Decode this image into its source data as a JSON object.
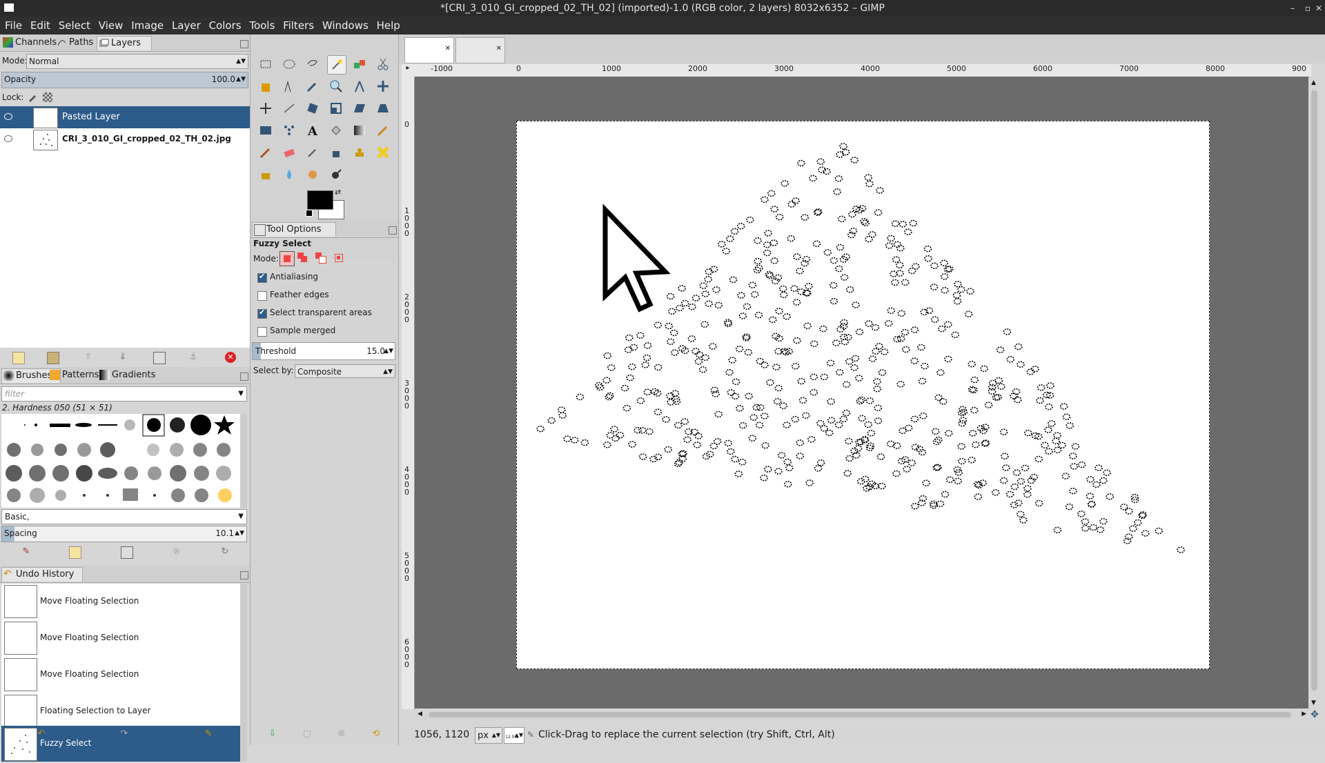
{
  "window": {
    "title": "*[CRI_3_010_GI_cropped_02_TH_02] (imported)-1.0 (RGB color, 2 layers) 8032x6352 – GIMP"
  },
  "menu": [
    "File",
    "Edit",
    "Select",
    "View",
    "Image",
    "Layer",
    "Colors",
    "Tools",
    "Filters",
    "Windows",
    "Help"
  ],
  "layers_dock": {
    "tabs": [
      "Channels",
      "Paths",
      "Layers"
    ],
    "mode_label": "Mode:",
    "mode_value": "Normal",
    "opacity_label": "Opacity",
    "opacity_value": "100.0",
    "lock_label": "Lock:",
    "layers": [
      {
        "name": "Pasted Layer",
        "selected": true
      },
      {
        "name": "CRI_3_010_GI_cropped_02_TH_02.jpg",
        "selected": false
      }
    ]
  },
  "brushes_dock": {
    "tabs": [
      "Brushes",
      "Patterns",
      "Gradients"
    ],
    "filter_placeholder": "filter",
    "brush_name": "2. Hardness 050 (51 × 51)",
    "preset_value": "Basic,",
    "spacing_label": "Spacing",
    "spacing_value": "10.1"
  },
  "undo_dock": {
    "tab": "Undo History",
    "items": [
      {
        "label": "Move Floating Selection",
        "selected": false
      },
      {
        "label": "Move Floating Selection",
        "selected": false
      },
      {
        "label": "Move Floating Selection",
        "selected": false
      },
      {
        "label": "Floating Selection to Layer",
        "selected": false
      },
      {
        "label": "Fuzzy Select",
        "selected": true
      }
    ]
  },
  "tool_options": {
    "tab": "Tool Options",
    "tool_name": "Fuzzy Select",
    "mode_label": "Mode:",
    "antialiasing": {
      "label": "Antialiasing",
      "checked": true
    },
    "feather": {
      "label": "Feather edges",
      "checked": false
    },
    "transparent": {
      "label": "Select transparent areas",
      "checked": true
    },
    "merged": {
      "label": "Sample merged",
      "checked": false
    },
    "threshold_label": "Threshold",
    "threshold_value": "15.0",
    "select_by_label": "Select by:",
    "select_by_value": "Composite"
  },
  "ruler": {
    "top_labels": [
      "-1000",
      "0",
      "1000",
      "2000",
      "3000",
      "4000",
      "5000",
      "6000",
      "7000",
      "8000",
      "900"
    ],
    "left_labels": [
      "0",
      "1000",
      "2000",
      "3000",
      "4000",
      "5000",
      "6000"
    ]
  },
  "status": {
    "coords": "1056, 1120",
    "unit": "px",
    "zoom": "12.5%",
    "message": "Click-Drag to replace the current selection (try Shift, Ctrl, Alt)"
  },
  "colors": {
    "selection": "#2d5b8a",
    "canvas_bg": "#6b6b6b",
    "menubar": "#2f2f2f"
  }
}
